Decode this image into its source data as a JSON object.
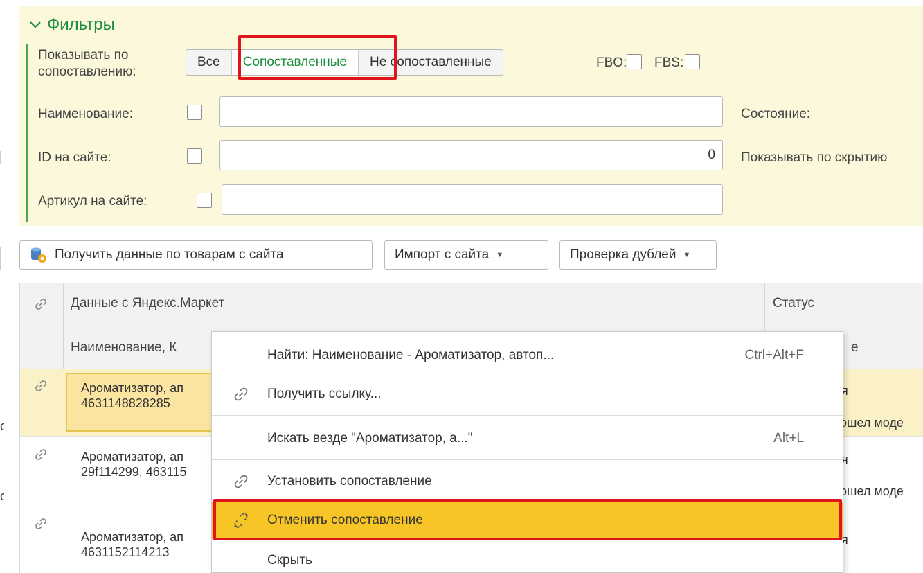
{
  "filters": {
    "title": "Фильтры",
    "show_by_mapping_label": "Показывать по сопоставлению:",
    "show_by_mapping_options": [
      "Все",
      "Сопоставленные",
      "Не сопоставленные"
    ],
    "selected_option": "Сопоставленные",
    "fbo_label": "FBO:",
    "fbs_label": "FBS:",
    "name_label": "Наименование:",
    "name_value": "",
    "site_id_label": "ID на сайте:",
    "site_id_value": "0",
    "article_label": "Артикул на сайте:",
    "article_value": "",
    "state_label": "Состояние:",
    "show_by_hidden_label": "Показывать по скрытию"
  },
  "toolbar": {
    "get_data_label": "Получить данные по товарам с сайта",
    "import_label": "Импорт с сайта",
    "duplicates_label": "Проверка дублей"
  },
  "table": {
    "group_header": "Данные с Яндекс.Маркет",
    "status_header": "Статус",
    "name_header": "Наименование, К",
    "status_sub_header": "е",
    "rows": [
      {
        "name": "Ароматизатор, ап",
        "codes": "4631148828285",
        "status1": "я",
        "status2": "ошел моде"
      },
      {
        "name": "Ароматизатор, ап",
        "codes": "29f114299, 463115",
        "status1": "я",
        "status2": "ошел моде"
      },
      {
        "name": "Ароматизатор, ап",
        "codes": "4631152114213",
        "status1": "я",
        "status2": ""
      }
    ],
    "left_edge_marks": [
      "о",
      "о"
    ]
  },
  "context_menu": {
    "items": [
      {
        "label": "Найти: Наименование -  Ароматизатор, автоп...",
        "shortcut": "Ctrl+Alt+F",
        "icon": "none"
      },
      {
        "label": "Получить ссылку...",
        "shortcut": "",
        "icon": "link-icon"
      },
      {
        "label": "Искать везде \"Ароматизатор, а...\"",
        "shortcut": "Alt+L",
        "icon": "none"
      },
      {
        "label": "Установить сопоставление",
        "shortcut": "",
        "icon": "link-icon"
      },
      {
        "label": "Отменить сопоставление",
        "shortcut": "",
        "icon": "broken-link-icon"
      },
      {
        "label": "Скрыть",
        "shortcut": "",
        "icon": "none"
      }
    ],
    "highlighted_item": "Отменить сопоставление"
  },
  "colors": {
    "filters_bg": "#fbf8dc",
    "accent_green": "#1d8f3e",
    "highlight_red": "#e0141c",
    "menu_highlight": "#f7c626",
    "selected_row": "#fbf1c7"
  }
}
